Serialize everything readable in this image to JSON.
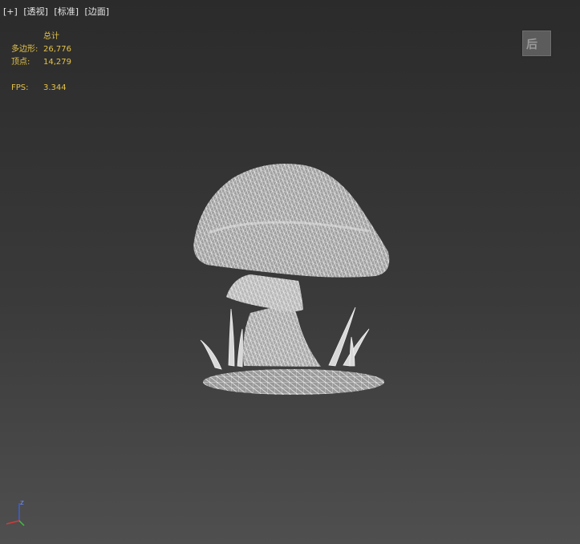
{
  "viewport": {
    "plus_label": "[+]",
    "view_label": "[透视]",
    "shading_label": "[标准]",
    "display_label": "[边面]"
  },
  "stats": {
    "header": "总计",
    "polygons_label": "多边形:",
    "polygons_value": "26,776",
    "vertices_label": "顶点:",
    "vertices_value": "14,279",
    "fps_label": "FPS:",
    "fps_value": "3.344"
  },
  "viewcube": {
    "icon": "viewcube-icon",
    "face_label": "后"
  },
  "gizmo": {
    "z_label": "z"
  },
  "colors": {
    "stats_text": "#e4c24a",
    "wire": "#e8e8e8",
    "bg_top": "#2b2b2b",
    "bg_bottom": "#4f4f4f"
  }
}
